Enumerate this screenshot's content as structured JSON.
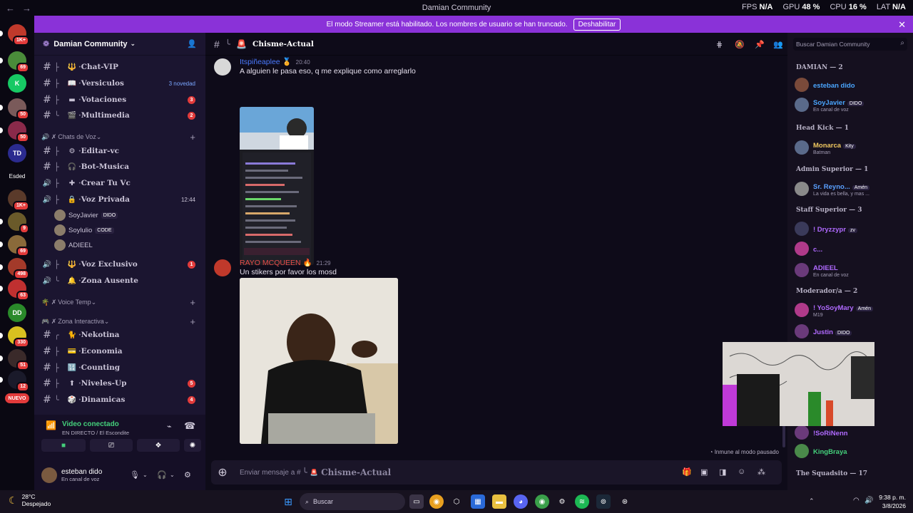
{
  "window": {
    "title": "Damian Community",
    "stats": [
      {
        "label": "FPS",
        "value": "N/A"
      },
      {
        "label": "GPU",
        "value": "48 %"
      },
      {
        "label": "CPU",
        "value": "16 %"
      },
      {
        "label": "LAT",
        "value": "N/A"
      }
    ]
  },
  "banner": {
    "text": "El modo Streamer está habilitado. Los nombres de usuario se han truncado.",
    "button": "Deshabilitar"
  },
  "servers": [
    {
      "label": "",
      "badge": "1K+",
      "color": "#c0392b"
    },
    {
      "label": "",
      "badge": "69",
      "color": "#4a8c3a"
    },
    {
      "label": "K",
      "badge": "",
      "color": "#17c964"
    },
    {
      "label": "",
      "badge": "50",
      "color": "#7a5a5a"
    },
    {
      "label": "",
      "badge": "50",
      "color": "#8a2a4a"
    },
    {
      "label": "TD",
      "badge": "54",
      "color": "#2b2b8f"
    },
    {
      "label": "Esded",
      "badge": "",
      "color": "#0a0812"
    },
    {
      "label": "",
      "badge": "1K+",
      "color": "#5a3a2a"
    },
    {
      "label": "",
      "badge": "9",
      "color": "#6a5a2a"
    },
    {
      "label": "",
      "badge": "69",
      "color": "#8a6a3a"
    },
    {
      "label": "",
      "badge": "498",
      "color": "#a33a2a"
    },
    {
      "label": "",
      "badge": "63",
      "color": "#c03030"
    },
    {
      "label": "DD",
      "badge": "27",
      "color": "#2a8a2a"
    },
    {
      "label": "",
      "badge": "330",
      "color": "#d8c020"
    },
    {
      "label": "",
      "badge": "51",
      "color": "#3a2a2a"
    },
    {
      "label": "",
      "badge": "12",
      "color": "#1a1a2a"
    },
    {
      "label": "NUEVO",
      "badge": "",
      "color": "#e23b3b"
    }
  ],
  "sidebar": {
    "server_name": "Damian Community",
    "channels": [
      {
        "emoji": "🔱",
        "name": "Chat-VIP",
        "type": "text",
        "tree": "├",
        "extra": ""
      },
      {
        "emoji": "📖",
        "name": "Versiculos",
        "type": "text",
        "tree": "├",
        "extra": "3 novedad"
      },
      {
        "emoji": "▬",
        "name": "Votaciones",
        "type": "text",
        "tree": "├",
        "extra": "",
        "count": "3"
      },
      {
        "emoji": "🎬",
        "name": "Multimedia",
        "type": "text",
        "tree": "╰",
        "extra": "",
        "count": "2"
      }
    ],
    "cat_voz": "Chats de Voz",
    "voice_channels": [
      {
        "emoji": "⚙",
        "name": "Editar-vc",
        "type": "text",
        "tree": "├"
      },
      {
        "emoji": "🎧",
        "name": "Bot-Musica",
        "type": "text",
        "tree": "├"
      },
      {
        "emoji": "✚",
        "name": "Crear Tu Vc",
        "type": "voice",
        "tree": "├"
      },
      {
        "emoji": "🔒",
        "name": "Voz Privada",
        "type": "voice",
        "tree": "├",
        "time": "12:44"
      }
    ],
    "voice_users": [
      {
        "name": "SoyJavier",
        "tag": "DIDO"
      },
      {
        "name": "Soylulio",
        "tag": "CODE"
      },
      {
        "name": "ADIEEL",
        "tag": ""
      }
    ],
    "more_channels": [
      {
        "emoji": "🔱",
        "name": "Voz Exclusivo",
        "type": "voice",
        "tree": "├",
        "count": "1"
      },
      {
        "emoji": "🔔",
        "name": "Zona Ausente",
        "type": "voice",
        "tree": "╰"
      }
    ],
    "cat_temp": "Voice Temp",
    "cat_inter": "Zona Interactiva",
    "inter_channels": [
      {
        "emoji": "🐈",
        "name": "Nekotina",
        "tree": "╭"
      },
      {
        "emoji": "💳",
        "name": "Economia",
        "tree": "├"
      },
      {
        "emoji": "🔢",
        "name": "Counting",
        "tree": "├"
      },
      {
        "emoji": "⬆",
        "name": "Niveles-Up",
        "tree": "├",
        "count": "5"
      },
      {
        "emoji": "🎲",
        "name": "Dinamicas",
        "tree": "╰",
        "count": "4"
      }
    ],
    "voice_panel": {
      "title": "Video conectado",
      "sub": "EN DIRECTO",
      "location": "/ El Escondite"
    },
    "user": {
      "name": "esteban dido",
      "status": "En canal de voz"
    }
  },
  "channel": {
    "name": "Chisme-Actual",
    "composer_placeholder": "Enviar mensaje a #",
    "immune": "Inmune al modo pausado"
  },
  "messages": [
    {
      "author": "Itspiñeaplee",
      "time": "20:40",
      "text": "A alguien le pasa eso, q me explique como arreglarlo",
      "color": "#4a7aff"
    },
    {
      "author": "RAYO MCQUEEN",
      "time": "21:29",
      "text": "Un stikers por favor los mosd",
      "color": "#e34a4a"
    }
  ],
  "members": {
    "search": "Buscar Damian Community",
    "groups": [
      {
        "name": "DAMIAN — 2",
        "members": [
          {
            "name": "esteban dido",
            "sub": "",
            "color": "#4aa6ff",
            "tag": ""
          },
          {
            "name": "SoyJavier",
            "sub": "En canal de voz",
            "color": "#4aa6ff",
            "tag": "DIDO"
          }
        ]
      },
      {
        "name": "Head Kick — 1",
        "members": [
          {
            "name": "Monarca",
            "sub": "Batman",
            "color": "#f0c860",
            "tag": "Kity"
          }
        ]
      },
      {
        "name": "Admin Superior — 1",
        "members": [
          {
            "name": "Sr. Reyno...",
            "sub": "La vida es bella, y mas ...",
            "color": "#5aa0ff",
            "tag": "Amén"
          }
        ]
      },
      {
        "name": "Staff Superior — 3",
        "members": [
          {
            "name": "! Dryzzypr",
            "sub": "",
            "color": "#b06aff",
            "tag": "zv"
          },
          {
            "name": "c...",
            "sub": "",
            "color": "#b06aff",
            "tag": ""
          },
          {
            "name": "ADIEEL",
            "sub": "En canal de voz",
            "color": "#b06aff",
            "tag": ""
          }
        ]
      },
      {
        "name": "Moderador/a — 2",
        "members": [
          {
            "name": "! YoSoyMary",
            "sub": "M19",
            "color": "#b06aff",
            "tag": "Amén"
          },
          {
            "name": "Justin",
            "sub": "",
            "color": "#b06aff",
            "tag": "DIDO"
          }
        ]
      },
      {
        "name": "",
        "members": [
          {
            "name": "!SoRiNenn",
            "sub": "",
            "color": "#b06aff",
            "tag": ""
          },
          {
            "name": "KingBraya",
            "sub": "",
            "color": "#44d07b",
            "tag": ""
          }
        ]
      },
      {
        "name": "The Squadsito — 17",
        "members": []
      }
    ]
  },
  "taskbar": {
    "weather_temp": "28°C",
    "weather_desc": "Despejado",
    "search": "Buscar",
    "time": "9:38 p. m.",
    "date": "3/8/2026"
  }
}
